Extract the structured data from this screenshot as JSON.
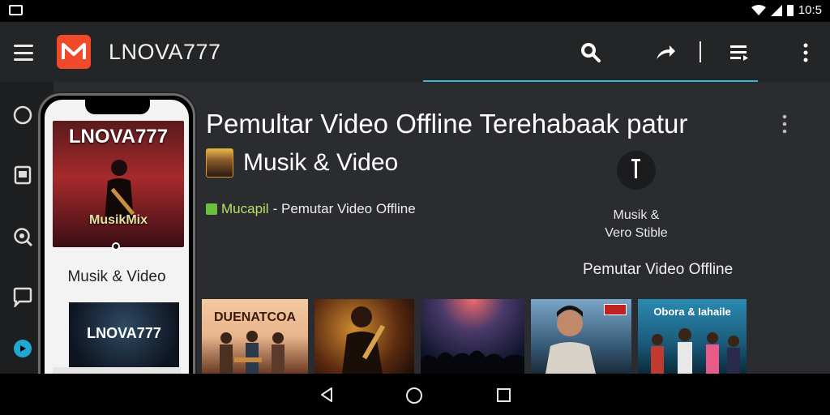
{
  "status_bar": {
    "time": "10:5"
  },
  "app_bar": {
    "title": "LNOVA777",
    "icons": [
      "menu-icon",
      "app-logo",
      "search-icon",
      "share-icon",
      "playlist-icon",
      "more-vert-icon"
    ]
  },
  "sidebar": {
    "icons": [
      "home-icon",
      "library-icon",
      "explore-icon",
      "chat-icon",
      "play-icon"
    ]
  },
  "phone": {
    "cover_title": "LNOVA777",
    "cover_subtitle": "MusikMix",
    "caption": "Musik & Video",
    "card_title": "LNOVA777",
    "controls": [
      "◀",
      "◀",
      "❚❚",
      "▶"
    ]
  },
  "main": {
    "headline": "Pemultar Video Offline  Terehabaak patur",
    "subtitle": "Musik & Video",
    "meta_highlight": "Mucapil",
    "meta_text": " - Pemutar Video Offline",
    "side_caption_1": "Musik &",
    "side_caption_2": "Vero Stible",
    "offline_label": "Pemutar Video Offline"
  },
  "thumbnails": [
    {
      "title": "DUENATCOA"
    },
    {
      "title": ""
    },
    {
      "title": ""
    },
    {
      "title": ""
    },
    {
      "title": "Obora & Iahaile"
    }
  ],
  "colors": {
    "accent": "#39b9c9",
    "logo": "#f04a2a",
    "appbar": "#232527",
    "main_bg": "#2a2c2f"
  }
}
